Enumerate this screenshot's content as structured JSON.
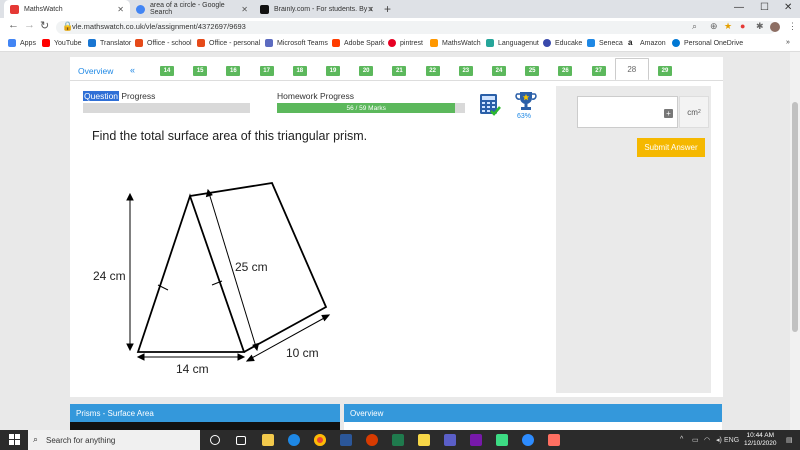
{
  "browser": {
    "tabs": [
      {
        "title": "MathsWatch",
        "color": "#e53935"
      },
      {
        "title": "area of a circle - Google Search",
        "color": "#4285f4"
      },
      {
        "title": "Brainly.com - For students. By stu",
        "color": "#111111"
      }
    ],
    "new_tab": "+",
    "url": "vle.mathswatch.co.uk/vle/assignment/4372697/9693",
    "bookmarks": [
      {
        "label": "Apps",
        "color": "#4285f4"
      },
      {
        "label": "YouTube",
        "color": "#ff0000"
      },
      {
        "label": "Translator",
        "color": "#1976d2"
      },
      {
        "label": "Office - school",
        "color": "#e64a19"
      },
      {
        "label": "Office - personal",
        "color": "#e64a19"
      },
      {
        "label": "Microsoft Teams",
        "color": "#5c6bc0"
      },
      {
        "label": "Adobe Spark",
        "color": "#ff3d00"
      },
      {
        "label": "pintrest",
        "color": "#e60023"
      },
      {
        "label": "MathsWatch",
        "color": "#ff9800"
      },
      {
        "label": "Languagenut",
        "color": "#26a69a"
      },
      {
        "label": "Educake",
        "color": "#3949ab"
      },
      {
        "label": "Seneca",
        "color": "#1e88e5"
      },
      {
        "label": "Amazon",
        "color": "#111111"
      },
      {
        "label": "Personal OneDrive",
        "color": "#0078d4"
      }
    ],
    "more_bookmarks": "»"
  },
  "nav": {
    "overview": "Overview",
    "prev": "«",
    "questions": [
      "14",
      "15",
      "16",
      "17",
      "18",
      "19",
      "20",
      "21",
      "22",
      "23",
      "24",
      "25",
      "26",
      "27",
      "28",
      "29"
    ],
    "current": "28"
  },
  "progress": {
    "question_label_hl": "Question",
    "question_label_rest": " Progress",
    "homework_label": "Homework Progress",
    "homework_text": "56 / 59 Marks",
    "homework_fraction": 0.949,
    "percent": "63%"
  },
  "question": {
    "text": "Find the total surface area of this triangular prism.",
    "diagram": {
      "height_label": "24 cm",
      "slant_label": "25 cm",
      "base_label": "14 cm",
      "length_label": "10 cm"
    }
  },
  "answer": {
    "unit": "cm",
    "unit_power": "2",
    "plus": "+",
    "submit": "Submit Answer"
  },
  "panels": {
    "left_title": "Prisms - Surface Area",
    "right_title": "Overview"
  },
  "taskbar": {
    "search_placeholder": "Search for anything",
    "lang": "ENG",
    "time": "10:44 AM",
    "date": "12/10/2020"
  }
}
